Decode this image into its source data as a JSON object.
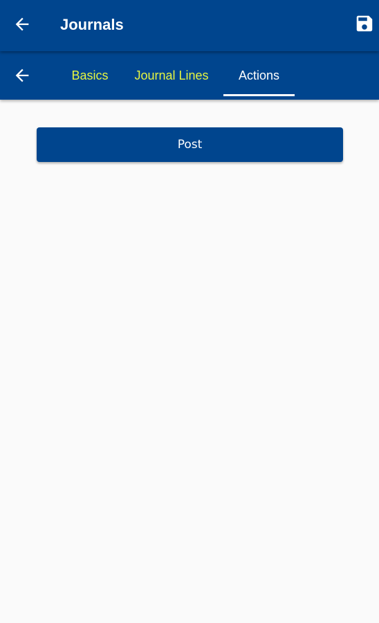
{
  "appbar": {
    "title": "Journals",
    "back_icon": "arrow-left-icon",
    "save_icon": "floppy-disk-icon",
    "background": "#00458e"
  },
  "tabs": {
    "back_icon": "arrow-left-icon",
    "items": [
      {
        "label": "Basics",
        "active": false
      },
      {
        "label": "Journal Lines",
        "active": false
      },
      {
        "label": "Actions",
        "active": true
      }
    ],
    "inactive_color": "#e6f542",
    "active_color": "#ffffff"
  },
  "actions": {
    "post_label": "Post"
  }
}
